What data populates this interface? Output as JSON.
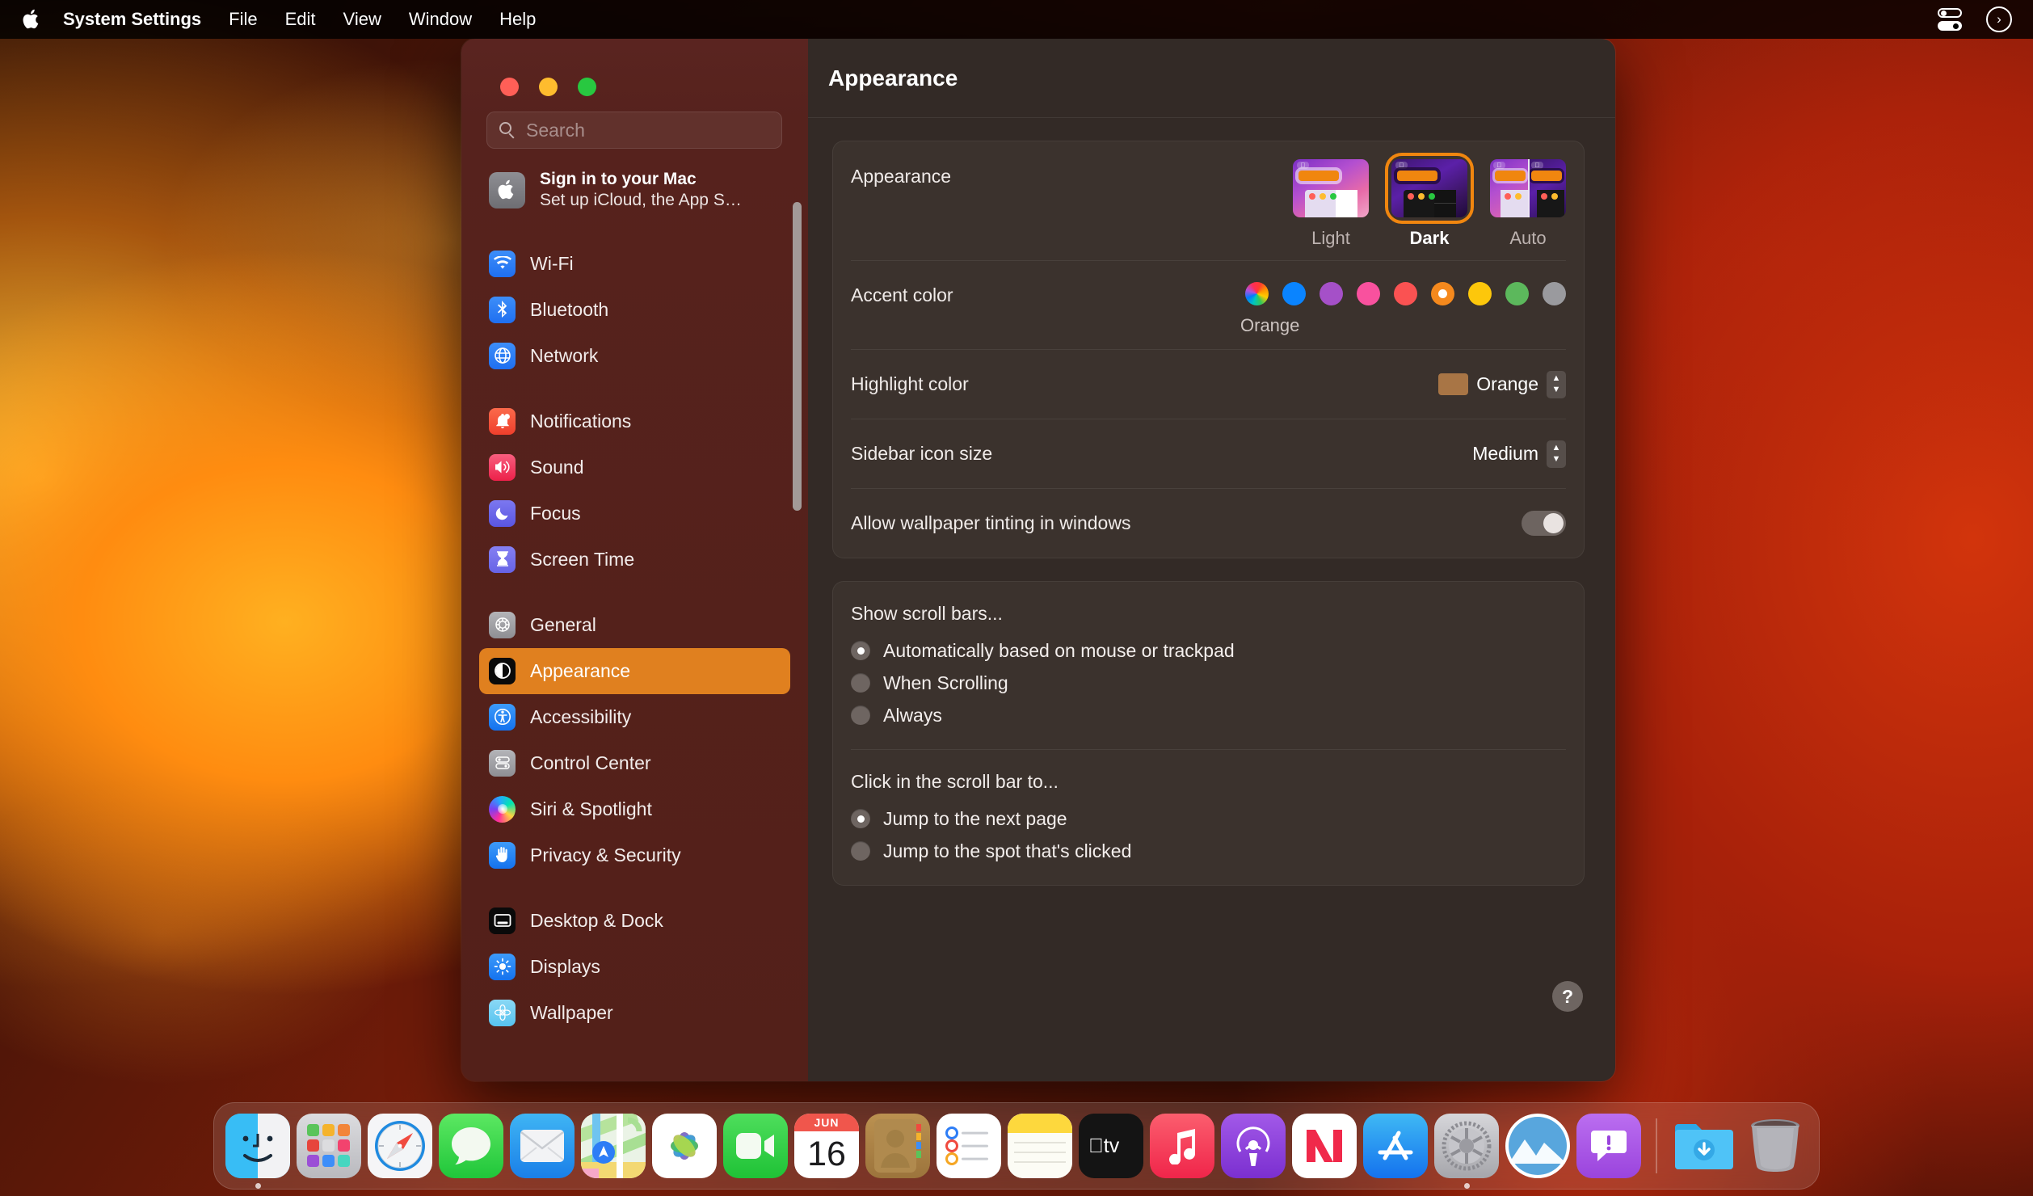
{
  "menubar": {
    "apple_icon": "apple-logo-icon",
    "items": [
      {
        "label": "System Settings",
        "bold": true
      },
      {
        "label": "File",
        "bold": false
      },
      {
        "label": "Edit",
        "bold": false
      },
      {
        "label": "View",
        "bold": false
      },
      {
        "label": "Window",
        "bold": false
      },
      {
        "label": "Help",
        "bold": false
      }
    ],
    "status_icons": [
      {
        "name": "control-center-icon"
      },
      {
        "name": "siri-icon",
        "glyph": "›"
      }
    ]
  },
  "window": {
    "traffic_lights": {
      "close": "Close",
      "minimize": "Minimize",
      "zoom": "Zoom"
    },
    "search": {
      "placeholder": "Search",
      "value": "",
      "icon": "search-icon"
    },
    "account": {
      "title": "Sign in to your Mac",
      "subtitle": "Set up iCloud, the App S…",
      "icon": "apple-account-icon"
    },
    "sidebar_groups": [
      {
        "items": [
          {
            "label": "Wi-Fi",
            "icon": "wifi-icon",
            "bg": "#2d7df6",
            "glyph": "◓"
          },
          {
            "label": "Bluetooth",
            "icon": "bluetooth-icon",
            "bg": "#2f84f7",
            "glyph": "ᛗ"
          },
          {
            "label": "Network",
            "icon": "network-globe-icon",
            "bg": "#2f84f7",
            "glyph": "⊕"
          }
        ]
      },
      {
        "items": [
          {
            "label": "Notifications",
            "icon": "notifications-bell-icon",
            "bg": "#f5523a",
            "glyph": "●"
          },
          {
            "label": "Sound",
            "icon": "sound-speaker-icon",
            "bg": "#f2365e",
            "glyph": "◀"
          },
          {
            "label": "Focus",
            "icon": "focus-moon-icon",
            "bg": "#6460e8",
            "glyph": "☾"
          },
          {
            "label": "Screen Time",
            "icon": "screen-time-hourglass-icon",
            "bg": "#6f6ae8",
            "glyph": "⧗"
          }
        ]
      },
      {
        "items": [
          {
            "label": "General",
            "icon": "general-gear-icon",
            "bg": "#9a9a9e",
            "glyph": "⚙"
          },
          {
            "label": "Appearance",
            "icon": "appearance-contrast-icon",
            "bg": "#111111",
            "glyph": "◐",
            "selected": true
          },
          {
            "label": "Accessibility",
            "icon": "accessibility-icon",
            "bg": "#1f7ff0",
            "glyph": "Ⓙ"
          },
          {
            "label": "Control Center",
            "icon": "control-center-icon",
            "bg": "#9a9a9e",
            "glyph": "☰"
          },
          {
            "label": "Siri & Spotlight",
            "icon": "siri-spotlight-icon",
            "bg": "#7a3ad0",
            "glyph": "●"
          },
          {
            "label": "Privacy & Security",
            "icon": "privacy-hand-icon",
            "bg": "#1f7ff0",
            "glyph": "✋"
          }
        ]
      },
      {
        "items": [
          {
            "label": "Desktop & Dock",
            "icon": "desktop-dock-icon",
            "bg": "#111111",
            "glyph": "▭"
          },
          {
            "label": "Displays",
            "icon": "displays-brightness-icon",
            "bg": "#2f84f7",
            "glyph": "☀"
          },
          {
            "label": "Wallpaper",
            "icon": "wallpaper-icon",
            "bg": "#6fc6ef",
            "glyph": "✿"
          }
        ]
      }
    ],
    "content": {
      "title": "Appearance",
      "appearance_row": {
        "label": "Appearance",
        "options": [
          {
            "label": "Light",
            "selected": false
          },
          {
            "label": "Dark",
            "selected": true
          },
          {
            "label": "Auto",
            "selected": false
          }
        ]
      },
      "accent_row": {
        "label": "Accent color",
        "selected_name": "Orange",
        "swatches": [
          {
            "name": "multicolor",
            "color": "multicolor",
            "selected": false
          },
          {
            "name": "blue",
            "color": "#0a84ff",
            "selected": false
          },
          {
            "name": "purple",
            "color": "#a550c8",
            "selected": false
          },
          {
            "name": "pink",
            "color": "#f9519e",
            "selected": false
          },
          {
            "name": "red",
            "color": "#fa5252",
            "selected": false
          },
          {
            "name": "orange",
            "color": "#f5891d",
            "selected": true
          },
          {
            "name": "yellow",
            "color": "#fdc70b",
            "selected": false
          },
          {
            "name": "green",
            "color": "#5cb85c",
            "selected": false
          },
          {
            "name": "graphite",
            "color": "#9a9a9e",
            "selected": false
          }
        ]
      },
      "highlight_row": {
        "label": "Highlight color",
        "value": "Orange",
        "chip_color": "#a87545"
      },
      "sidebar_icon_row": {
        "label": "Sidebar icon size",
        "value": "Medium"
      },
      "tinting_row": {
        "label": "Allow wallpaper tinting in windows",
        "enabled": true
      },
      "scrollbar_section": {
        "title": "Show scroll bars...",
        "options": [
          {
            "label": "Automatically based on mouse or trackpad",
            "selected": true
          },
          {
            "label": "When Scrolling",
            "selected": false
          },
          {
            "label": "Always",
            "selected": false
          }
        ]
      },
      "scrollclick_section": {
        "title": "Click in the scroll bar to...",
        "options": [
          {
            "label": "Jump to the next page",
            "selected": true
          },
          {
            "label": "Jump to the spot that's clicked",
            "selected": false
          }
        ]
      },
      "help_button": {
        "label": "?"
      }
    }
  },
  "dock": {
    "items": [
      {
        "name": "finder",
        "running": true
      },
      {
        "name": "launchpad",
        "running": false
      },
      {
        "name": "safari",
        "running": false
      },
      {
        "name": "messages",
        "running": false
      },
      {
        "name": "mail",
        "running": false
      },
      {
        "name": "maps",
        "running": false
      },
      {
        "name": "photos",
        "running": false
      },
      {
        "name": "facetime",
        "running": false
      },
      {
        "name": "calendar",
        "running": false,
        "month": "JUN",
        "day": "16"
      },
      {
        "name": "contacts",
        "running": false
      },
      {
        "name": "reminders",
        "running": false
      },
      {
        "name": "notes",
        "running": false
      },
      {
        "name": "tv",
        "running": false
      },
      {
        "name": "music",
        "running": false
      },
      {
        "name": "podcasts",
        "running": false
      },
      {
        "name": "news",
        "running": false
      },
      {
        "name": "app-store",
        "running": false
      },
      {
        "name": "system-settings",
        "running": true
      },
      {
        "name": "freeform",
        "running": false
      },
      {
        "name": "feedback-assistant",
        "running": false
      },
      {
        "name": "downloads-folder",
        "running": false
      },
      {
        "name": "trash",
        "running": false
      }
    ]
  }
}
